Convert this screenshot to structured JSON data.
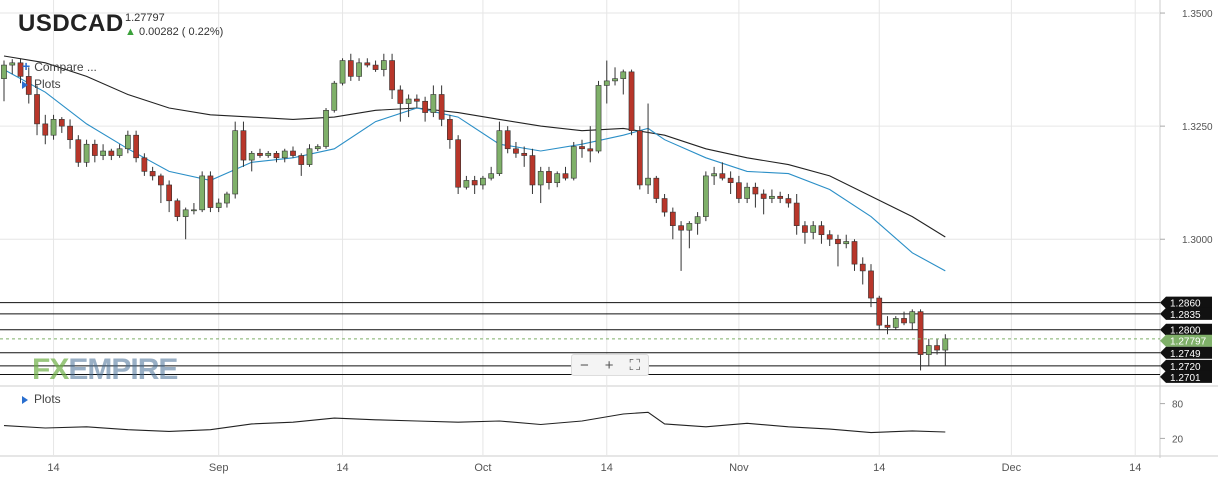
{
  "header": {
    "symbol": "USDCAD",
    "price": "1.27797",
    "change": "0.00282 ( 0.22%)",
    "compare_label": "Compare ...",
    "plots_label": "Plots",
    "plots_label_2": "Plots"
  },
  "logo": {
    "fx": "FX",
    "rest": "EMPIRE"
  },
  "zoom": {
    "minus": "−",
    "plus": "+",
    "fit": "⛶"
  },
  "colors": {
    "up": "#7fb069",
    "down": "#b8362a",
    "ma_fast": "#2b8fc7",
    "ma_slow": "#222222",
    "grid": "#e6e6e6"
  },
  "chart_data": {
    "type": "candlestick",
    "ylim": [
      1.268,
      1.352
    ],
    "price_ticks": [
      "1.3500",
      "1.3250",
      "1.3000"
    ],
    "price_tick_values": [
      1.35,
      1.325,
      1.3
    ],
    "x_labels": [
      "14",
      "Sep",
      "14",
      "Oct",
      "14",
      "Nov",
      "14",
      "Dec",
      "14"
    ],
    "x_label_index": [
      6,
      26,
      41,
      58,
      73,
      89,
      106,
      122,
      137
    ],
    "n_bars": 140,
    "levels": [
      {
        "value": 1.286,
        "label": "1.2860"
      },
      {
        "value": 1.2835,
        "label": "1.2835"
      },
      {
        "value": 1.28,
        "label": "1.2800"
      },
      {
        "value": 1.2749,
        "label": "1.2749"
      },
      {
        "value": 1.272,
        "label": "1.2720"
      },
      {
        "value": 1.2701,
        "label": "1.2701"
      }
    ],
    "current": {
      "value": 1.27797,
      "label": "1.27797"
    },
    "candles": [
      [
        0,
        1.3355,
        1.3395,
        1.3305,
        1.3385
      ],
      [
        1,
        1.3385,
        1.3398,
        1.3365,
        1.339
      ],
      [
        2,
        1.339,
        1.34,
        1.3345,
        1.336
      ],
      [
        3,
        1.336,
        1.338,
        1.33,
        1.332
      ],
      [
        4,
        1.332,
        1.334,
        1.323,
        1.3255
      ],
      [
        5,
        1.3255,
        1.3275,
        1.321,
        1.323
      ],
      [
        6,
        1.323,
        1.3275,
        1.322,
        1.3265
      ],
      [
        7,
        1.3265,
        1.327,
        1.3235,
        1.325
      ],
      [
        8,
        1.325,
        1.3265,
        1.32,
        1.322
      ],
      [
        9,
        1.322,
        1.323,
        1.316,
        1.317
      ],
      [
        10,
        1.317,
        1.322,
        1.316,
        1.321
      ],
      [
        11,
        1.321,
        1.322,
        1.317,
        1.3185
      ],
      [
        12,
        1.3185,
        1.321,
        1.3175,
        1.3195
      ],
      [
        13,
        1.3195,
        1.32,
        1.3175,
        1.3185
      ],
      [
        14,
        1.3185,
        1.321,
        1.318,
        1.32
      ],
      [
        15,
        1.32,
        1.324,
        1.319,
        1.323
      ],
      [
        16,
        1.323,
        1.324,
        1.317,
        1.318
      ],
      [
        17,
        1.318,
        1.319,
        1.314,
        1.315
      ],
      [
        18,
        1.315,
        1.316,
        1.313,
        1.314
      ],
      [
        19,
        1.314,
        1.3145,
        1.308,
        1.312
      ],
      [
        20,
        1.312,
        1.313,
        1.306,
        1.3085
      ],
      [
        21,
        1.3085,
        1.309,
        1.304,
        1.305
      ],
      [
        22,
        1.305,
        1.307,
        1.3,
        1.3065
      ],
      [
        23,
        1.3065,
        1.308,
        1.3055,
        1.3065
      ],
      [
        24,
        1.3065,
        1.315,
        1.306,
        1.314
      ],
      [
        25,
        1.314,
        1.315,
        1.306,
        1.307
      ],
      [
        26,
        1.307,
        1.309,
        1.306,
        1.308
      ],
      [
        27,
        1.308,
        1.3105,
        1.307,
        1.31
      ],
      [
        28,
        1.31,
        1.326,
        1.309,
        1.324
      ],
      [
        29,
        1.324,
        1.326,
        1.316,
        1.3175
      ],
      [
        30,
        1.3175,
        1.3195,
        1.315,
        1.319
      ],
      [
        31,
        1.319,
        1.32,
        1.318,
        1.3185
      ],
      [
        32,
        1.3185,
        1.3195,
        1.318,
        1.319
      ],
      [
        33,
        1.319,
        1.3195,
        1.317,
        1.318
      ],
      [
        34,
        1.318,
        1.32,
        1.317,
        1.3195
      ],
      [
        35,
        1.3195,
        1.3205,
        1.318,
        1.3185
      ],
      [
        36,
        1.3185,
        1.319,
        1.314,
        1.3165
      ],
      [
        37,
        1.3165,
        1.321,
        1.316,
        1.32
      ],
      [
        38,
        1.32,
        1.321,
        1.3195,
        1.3205
      ],
      [
        39,
        1.3205,
        1.329,
        1.32,
        1.3285
      ],
      [
        40,
        1.3285,
        1.335,
        1.328,
        1.3345
      ],
      [
        41,
        1.3345,
        1.34,
        1.334,
        1.3395
      ],
      [
        42,
        1.3395,
        1.341,
        1.335,
        1.336
      ],
      [
        43,
        1.336,
        1.34,
        1.335,
        1.339
      ],
      [
        44,
        1.339,
        1.34,
        1.338,
        1.3385
      ],
      [
        45,
        1.3385,
        1.3395,
        1.337,
        1.3375
      ],
      [
        46,
        1.3375,
        1.341,
        1.336,
        1.3395
      ],
      [
        47,
        1.3395,
        1.341,
        1.331,
        1.333
      ],
      [
        48,
        1.333,
        1.334,
        1.326,
        1.33
      ],
      [
        49,
        1.33,
        1.332,
        1.327,
        1.331
      ],
      [
        50,
        1.331,
        1.332,
        1.329,
        1.3305
      ],
      [
        51,
        1.3305,
        1.3315,
        1.326,
        1.328
      ],
      [
        52,
        1.328,
        1.334,
        1.327,
        1.332
      ],
      [
        53,
        1.332,
        1.334,
        1.325,
        1.3265
      ],
      [
        54,
        1.3265,
        1.3275,
        1.32,
        1.322
      ],
      [
        55,
        1.322,
        1.323,
        1.31,
        1.3115
      ],
      [
        56,
        1.3115,
        1.314,
        1.311,
        1.313
      ],
      [
        57,
        1.313,
        1.314,
        1.31,
        1.312
      ],
      [
        58,
        1.312,
        1.314,
        1.311,
        1.3135
      ],
      [
        59,
        1.3135,
        1.316,
        1.313,
        1.3145
      ],
      [
        60,
        1.3145,
        1.326,
        1.314,
        1.324
      ],
      [
        61,
        1.324,
        1.325,
        1.319,
        1.32
      ],
      [
        62,
        1.32,
        1.3215,
        1.318,
        1.319
      ],
      [
        63,
        1.319,
        1.3205,
        1.316,
        1.3185
      ],
      [
        64,
        1.3185,
        1.32,
        1.31,
        1.312
      ],
      [
        65,
        1.312,
        1.316,
        1.308,
        1.315
      ],
      [
        66,
        1.315,
        1.316,
        1.311,
        1.3125
      ],
      [
        67,
        1.3125,
        1.315,
        1.3115,
        1.3145
      ],
      [
        68,
        1.3145,
        1.316,
        1.313,
        1.3135
      ],
      [
        69,
        1.3135,
        1.3215,
        1.313,
        1.3205
      ],
      [
        70,
        1.3205,
        1.322,
        1.318,
        1.32
      ],
      [
        71,
        1.32,
        1.325,
        1.317,
        1.3195
      ],
      [
        72,
        1.3195,
        1.335,
        1.319,
        1.334
      ],
      [
        73,
        1.334,
        1.3395,
        1.33,
        1.335
      ],
      [
        74,
        1.335,
        1.338,
        1.334,
        1.3355
      ],
      [
        75,
        1.3355,
        1.3375,
        1.332,
        1.337
      ],
      [
        76,
        1.337,
        1.3375,
        1.323,
        1.324
      ],
      [
        77,
        1.324,
        1.325,
        1.311,
        1.312
      ],
      [
        78,
        1.312,
        1.33,
        1.31,
        1.3135
      ],
      [
        79,
        1.3135,
        1.314,
        1.308,
        1.309
      ],
      [
        80,
        1.309,
        1.31,
        1.305,
        1.306
      ],
      [
        81,
        1.306,
        1.307,
        1.3,
        1.303
      ],
      [
        82,
        1.303,
        1.304,
        1.293,
        1.302
      ],
      [
        83,
        1.302,
        1.304,
        1.298,
        1.3035
      ],
      [
        84,
        1.3035,
        1.306,
        1.301,
        1.305
      ],
      [
        85,
        1.305,
        1.315,
        1.304,
        1.314
      ],
      [
        86,
        1.314,
        1.316,
        1.312,
        1.3145
      ],
      [
        87,
        1.3145,
        1.317,
        1.313,
        1.3135
      ],
      [
        88,
        1.3135,
        1.315,
        1.31,
        1.3125
      ],
      [
        89,
        1.3125,
        1.314,
        1.308,
        1.309
      ],
      [
        90,
        1.309,
        1.3125,
        1.308,
        1.3115
      ],
      [
        91,
        1.3115,
        1.3125,
        1.307,
        1.31
      ],
      [
        92,
        1.31,
        1.311,
        1.3055,
        1.309
      ],
      [
        93,
        1.309,
        1.311,
        1.308,
        1.3095
      ],
      [
        94,
        1.3095,
        1.3105,
        1.308,
        1.309
      ],
      [
        95,
        1.309,
        1.31,
        1.307,
        1.308
      ],
      [
        96,
        1.308,
        1.31,
        1.301,
        1.303
      ],
      [
        97,
        1.303,
        1.304,
        1.299,
        1.3015
      ],
      [
        98,
        1.3015,
        1.304,
        1.3,
        1.303
      ],
      [
        99,
        1.303,
        1.304,
        1.299,
        1.301
      ],
      [
        100,
        1.301,
        1.302,
        1.2985,
        1.3
      ],
      [
        101,
        1.3,
        1.301,
        1.294,
        1.299
      ],
      [
        102,
        1.299,
        1.301,
        1.298,
        1.2995
      ],
      [
        103,
        1.2995,
        1.3,
        1.293,
        1.2945
      ],
      [
        104,
        1.2945,
        1.296,
        1.29,
        1.293
      ],
      [
        105,
        1.293,
        1.2945,
        1.285,
        1.287
      ],
      [
        106,
        1.287,
        1.2875,
        1.28,
        1.281
      ],
      [
        107,
        1.281,
        1.283,
        1.279,
        1.2805
      ],
      [
        108,
        1.2805,
        1.283,
        1.28,
        1.2825
      ],
      [
        109,
        1.2825,
        1.284,
        1.281,
        1.2815
      ],
      [
        110,
        1.2815,
        1.2845,
        1.28,
        1.284
      ],
      [
        111,
        1.284,
        1.2845,
        1.271,
        1.2745
      ],
      [
        112,
        1.2745,
        1.278,
        1.272,
        1.2765
      ],
      [
        113,
        1.2765,
        1.278,
        1.2745,
        1.2755
      ],
      [
        114,
        1.2755,
        1.279,
        1.272,
        1.278
      ]
    ],
    "ma_fast": [
      [
        0,
        1.3375
      ],
      [
        5,
        1.3325
      ],
      [
        10,
        1.3255
      ],
      [
        15,
        1.32
      ],
      [
        20,
        1.315
      ],
      [
        25,
        1.313
      ],
      [
        30,
        1.317
      ],
      [
        35,
        1.318
      ],
      [
        40,
        1.32
      ],
      [
        45,
        1.326
      ],
      [
        50,
        1.329
      ],
      [
        55,
        1.327
      ],
      [
        60,
        1.321
      ],
      [
        65,
        1.3195
      ],
      [
        70,
        1.321
      ],
      [
        75,
        1.323
      ],
      [
        78,
        1.3245
      ],
      [
        80,
        1.322
      ],
      [
        85,
        1.318
      ],
      [
        90,
        1.315
      ],
      [
        95,
        1.3145
      ],
      [
        100,
        1.311
      ],
      [
        105,
        1.305
      ],
      [
        110,
        1.297
      ],
      [
        114,
        1.293
      ]
    ],
    "ma_slow": [
      [
        0,
        1.3405
      ],
      [
        5,
        1.339
      ],
      [
        10,
        1.336
      ],
      [
        15,
        1.332
      ],
      [
        20,
        1.329
      ],
      [
        25,
        1.3275
      ],
      [
        30,
        1.327
      ],
      [
        35,
        1.3265
      ],
      [
        40,
        1.327
      ],
      [
        45,
        1.3285
      ],
      [
        50,
        1.329
      ],
      [
        55,
        1.328
      ],
      [
        60,
        1.3265
      ],
      [
        65,
        1.325
      ],
      [
        70,
        1.324
      ],
      [
        75,
        1.3245
      ],
      [
        80,
        1.323
      ],
      [
        85,
        1.32
      ],
      [
        90,
        1.318
      ],
      [
        95,
        1.3165
      ],
      [
        100,
        1.314
      ],
      [
        105,
        1.3095
      ],
      [
        110,
        1.305
      ],
      [
        114,
        1.3005
      ]
    ],
    "osc_ylim": [
      0,
      100
    ],
    "osc_ticks": [
      "80",
      "20"
    ],
    "osc_tick_values": [
      80,
      20
    ],
    "oscillator": [
      [
        0,
        42
      ],
      [
        5,
        38
      ],
      [
        10,
        40
      ],
      [
        15,
        35
      ],
      [
        20,
        32
      ],
      [
        25,
        35
      ],
      [
        30,
        45
      ],
      [
        35,
        48
      ],
      [
        40,
        55
      ],
      [
        45,
        52
      ],
      [
        50,
        50
      ],
      [
        55,
        48
      ],
      [
        60,
        50
      ],
      [
        65,
        44
      ],
      [
        70,
        50
      ],
      [
        75,
        62
      ],
      [
        78,
        65
      ],
      [
        80,
        45
      ],
      [
        85,
        40
      ],
      [
        90,
        46
      ],
      [
        95,
        40
      ],
      [
        100,
        36
      ],
      [
        105,
        30
      ],
      [
        110,
        33
      ],
      [
        114,
        31
      ]
    ]
  }
}
